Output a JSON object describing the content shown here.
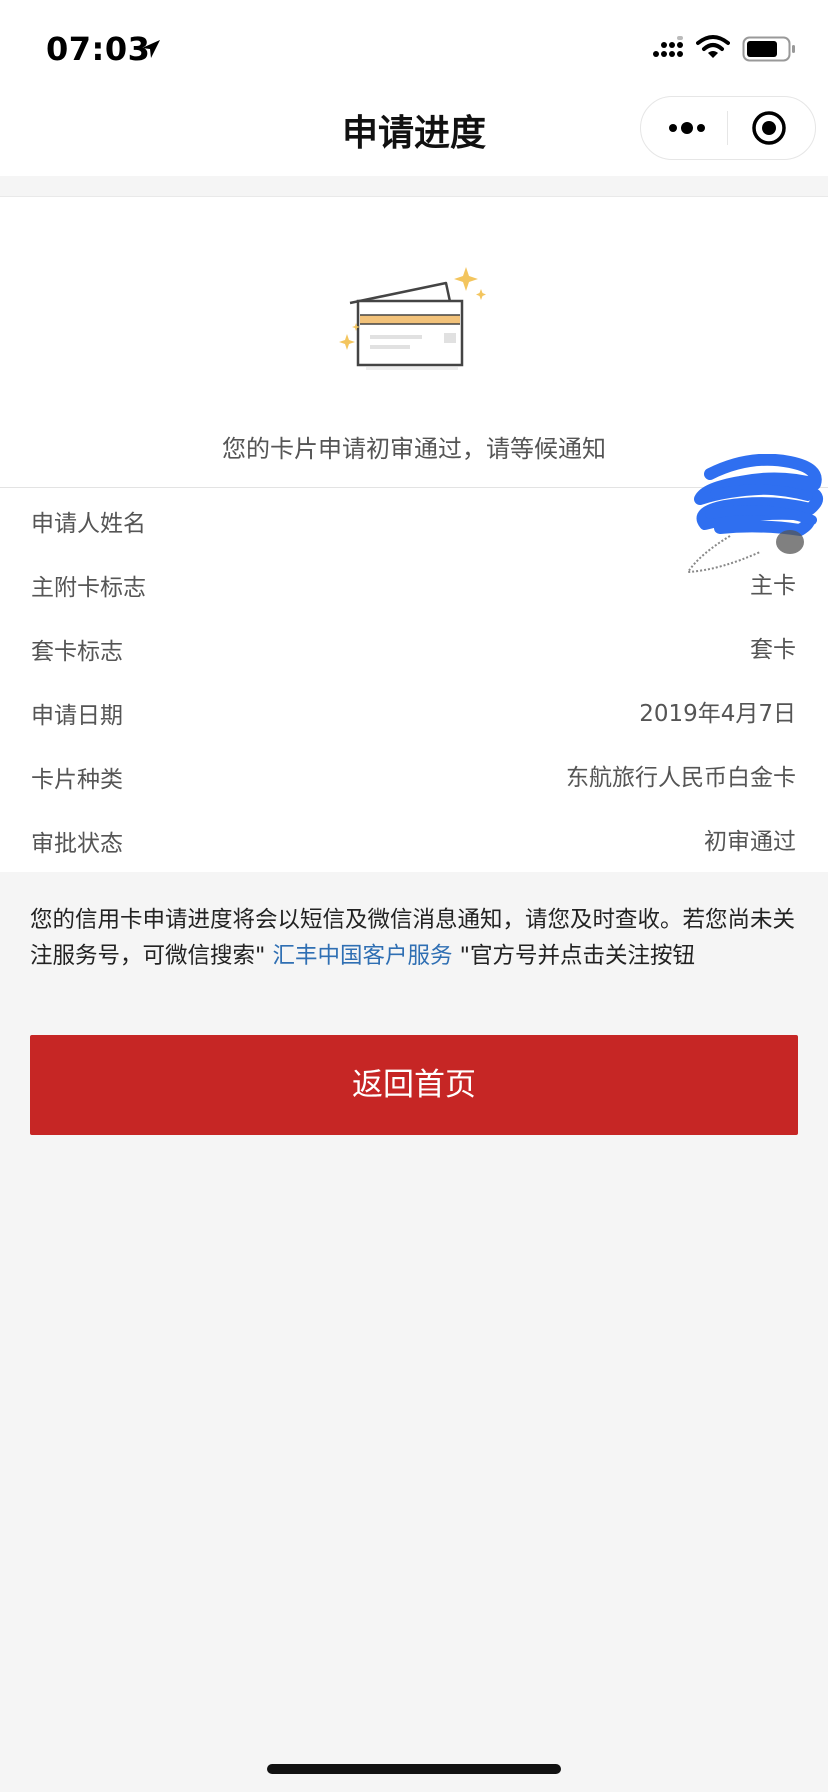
{
  "status_bar": {
    "time": "07:03"
  },
  "nav": {
    "title": "申请进度"
  },
  "status_message": "您的卡片申请初审通过，请等候通知",
  "details": [
    {
      "label": "申请人姓名",
      "value": ""
    },
    {
      "label": "主附卡标志",
      "value": "主卡"
    },
    {
      "label": "套卡标志",
      "value": "套卡"
    },
    {
      "label": "申请日期",
      "value": "2019年4月7日"
    },
    {
      "label": "卡片种类",
      "value": "东航旅行人民币白金卡"
    },
    {
      "label": "审批状态",
      "value": "初审通过"
    }
  ],
  "notice": {
    "part1": "您的信用卡申请进度将会以短信及微信消息通知，请您及时查收。若您尚未关注服务号，可微信搜索\" ",
    "link": "汇丰中国客户服务",
    "part2": " \"官方号并点击关注按钮"
  },
  "home_button_label": "返回首页",
  "colors": {
    "primary_red": "#c62625",
    "link_blue": "#2f6fb3",
    "redaction_blue": "#2f6ff0"
  },
  "icons": [
    "location-arrow-icon",
    "cellular-signal-icon",
    "wifi-icon",
    "battery-icon",
    "more-dots-icon",
    "target-close-icon",
    "credit-card-illustration"
  ]
}
